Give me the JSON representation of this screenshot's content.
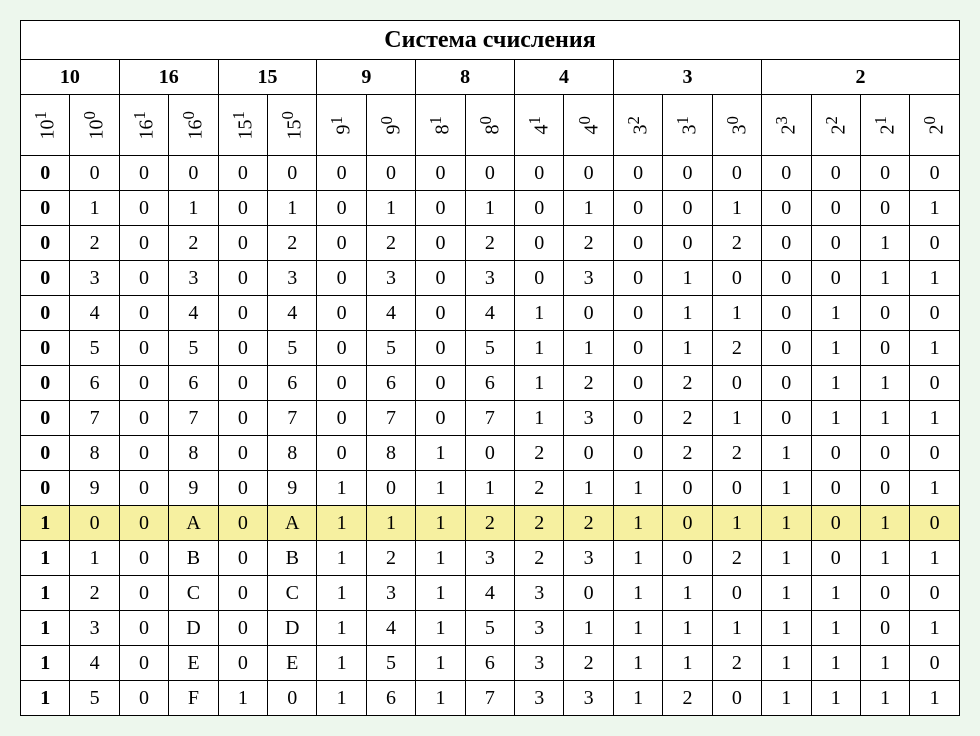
{
  "title": "Система счисления",
  "bases": [
    {
      "label": "10",
      "span": 2,
      "digits": [
        "10<sup>1</sup>",
        "10<sup>0</sup>"
      ]
    },
    {
      "label": "16",
      "span": 2,
      "digits": [
        "16<sup>1</sup>",
        "16<sup>0</sup>"
      ]
    },
    {
      "label": "15",
      "span": 2,
      "digits": [
        "15<sup>1</sup>",
        "15<sup>0</sup>"
      ]
    },
    {
      "label": "9",
      "span": 2,
      "digits": [
        "9<sup>1</sup>",
        "9<sup>0</sup>"
      ]
    },
    {
      "label": "8",
      "span": 2,
      "digits": [
        "8<sup>1</sup>",
        "8<sup>0</sup>"
      ]
    },
    {
      "label": "4",
      "span": 2,
      "digits": [
        "4<sup>1</sup>",
        "4<sup>0</sup>"
      ]
    },
    {
      "label": "3",
      "span": 3,
      "digits": [
        "3<sup>2</sup>",
        "3<sup>1</sup>",
        "3<sup>0</sup>"
      ]
    },
    {
      "label": "2",
      "span": 4,
      "digits": [
        "2<sup>3</sup>",
        "2<sup>2</sup>",
        "2<sup>1</sup>",
        "2<sup>0</sup>"
      ]
    }
  ],
  "highlight_row": 10,
  "rows": [
    [
      "0",
      "0",
      "0",
      "0",
      "0",
      "0",
      "0",
      "0",
      "0",
      "0",
      "0",
      "0",
      "0",
      "0",
      "0",
      "0",
      "0",
      "0",
      "0"
    ],
    [
      "0",
      "1",
      "0",
      "1",
      "0",
      "1",
      "0",
      "1",
      "0",
      "1",
      "0",
      "1",
      "0",
      "0",
      "1",
      "0",
      "0",
      "0",
      "1"
    ],
    [
      "0",
      "2",
      "0",
      "2",
      "0",
      "2",
      "0",
      "2",
      "0",
      "2",
      "0",
      "2",
      "0",
      "0",
      "2",
      "0",
      "0",
      "1",
      "0"
    ],
    [
      "0",
      "3",
      "0",
      "3",
      "0",
      "3",
      "0",
      "3",
      "0",
      "3",
      "0",
      "3",
      "0",
      "1",
      "0",
      "0",
      "0",
      "1",
      "1"
    ],
    [
      "0",
      "4",
      "0",
      "4",
      "0",
      "4",
      "0",
      "4",
      "0",
      "4",
      "1",
      "0",
      "0",
      "1",
      "1",
      "0",
      "1",
      "0",
      "0"
    ],
    [
      "0",
      "5",
      "0",
      "5",
      "0",
      "5",
      "0",
      "5",
      "0",
      "5",
      "1",
      "1",
      "0",
      "1",
      "2",
      "0",
      "1",
      "0",
      "1"
    ],
    [
      "0",
      "6",
      "0",
      "6",
      "0",
      "6",
      "0",
      "6",
      "0",
      "6",
      "1",
      "2",
      "0",
      "2",
      "0",
      "0",
      "1",
      "1",
      "0"
    ],
    [
      "0",
      "7",
      "0",
      "7",
      "0",
      "7",
      "0",
      "7",
      "0",
      "7",
      "1",
      "3",
      "0",
      "2",
      "1",
      "0",
      "1",
      "1",
      "1"
    ],
    [
      "0",
      "8",
      "0",
      "8",
      "0",
      "8",
      "0",
      "8",
      "1",
      "0",
      "2",
      "0",
      "0",
      "2",
      "2",
      "1",
      "0",
      "0",
      "0"
    ],
    [
      "0",
      "9",
      "0",
      "9",
      "0",
      "9",
      "1",
      "0",
      "1",
      "1",
      "2",
      "1",
      "1",
      "0",
      "0",
      "1",
      "0",
      "0",
      "1"
    ],
    [
      "1",
      "0",
      "0",
      "A",
      "0",
      "A",
      "1",
      "1",
      "1",
      "2",
      "2",
      "2",
      "1",
      "0",
      "1",
      "1",
      "0",
      "1",
      "0"
    ],
    [
      "1",
      "1",
      "0",
      "B",
      "0",
      "B",
      "1",
      "2",
      "1",
      "3",
      "2",
      "3",
      "1",
      "0",
      "2",
      "1",
      "0",
      "1",
      "1"
    ],
    [
      "1",
      "2",
      "0",
      "C",
      "0",
      "C",
      "1",
      "3",
      "1",
      "4",
      "3",
      "0",
      "1",
      "1",
      "0",
      "1",
      "1",
      "0",
      "0"
    ],
    [
      "1",
      "3",
      "0",
      "D",
      "0",
      "D",
      "1",
      "4",
      "1",
      "5",
      "3",
      "1",
      "1",
      "1",
      "1",
      "1",
      "1",
      "0",
      "1"
    ],
    [
      "1",
      "4",
      "0",
      "E",
      "0",
      "E",
      "1",
      "5",
      "1",
      "6",
      "3",
      "2",
      "1",
      "1",
      "2",
      "1",
      "1",
      "1",
      "0"
    ],
    [
      "1",
      "5",
      "0",
      "F",
      "1",
      "0",
      "1",
      "6",
      "1",
      "7",
      "3",
      "3",
      "1",
      "2",
      "0",
      "1",
      "1",
      "1",
      "1"
    ]
  ],
  "chart_data": {
    "type": "table",
    "title": "Система счисления",
    "columns": [
      "10^1",
      "10^0",
      "16^1",
      "16^0",
      "15^1",
      "15^0",
      "9^1",
      "9^0",
      "8^1",
      "8^0",
      "4^1",
      "4^0",
      "3^2",
      "3^1",
      "3^0",
      "2^3",
      "2^2",
      "2^1",
      "2^0"
    ],
    "column_groups": [
      {
        "base": 10,
        "cols": 2
      },
      {
        "base": 16,
        "cols": 2
      },
      {
        "base": 15,
        "cols": 2
      },
      {
        "base": 9,
        "cols": 2
      },
      {
        "base": 8,
        "cols": 2
      },
      {
        "base": 4,
        "cols": 2
      },
      {
        "base": 3,
        "cols": 3
      },
      {
        "base": 2,
        "cols": 4
      }
    ],
    "highlight_row_index": 10,
    "rows": [
      [
        "0",
        "0",
        "0",
        "0",
        "0",
        "0",
        "0",
        "0",
        "0",
        "0",
        "0",
        "0",
        "0",
        "0",
        "0",
        "0",
        "0",
        "0",
        "0"
      ],
      [
        "0",
        "1",
        "0",
        "1",
        "0",
        "1",
        "0",
        "1",
        "0",
        "1",
        "0",
        "1",
        "0",
        "0",
        "1",
        "0",
        "0",
        "0",
        "1"
      ],
      [
        "0",
        "2",
        "0",
        "2",
        "0",
        "2",
        "0",
        "2",
        "0",
        "2",
        "0",
        "2",
        "0",
        "0",
        "2",
        "0",
        "0",
        "1",
        "0"
      ],
      [
        "0",
        "3",
        "0",
        "3",
        "0",
        "3",
        "0",
        "3",
        "0",
        "3",
        "0",
        "3",
        "0",
        "1",
        "0",
        "0",
        "0",
        "1",
        "1"
      ],
      [
        "0",
        "4",
        "0",
        "4",
        "0",
        "4",
        "0",
        "4",
        "0",
        "4",
        "1",
        "0",
        "0",
        "1",
        "1",
        "0",
        "1",
        "0",
        "0"
      ],
      [
        "0",
        "5",
        "0",
        "5",
        "0",
        "5",
        "0",
        "5",
        "0",
        "5",
        "1",
        "1",
        "0",
        "1",
        "2",
        "0",
        "1",
        "0",
        "1"
      ],
      [
        "0",
        "6",
        "0",
        "6",
        "0",
        "6",
        "0",
        "6",
        "0",
        "6",
        "1",
        "2",
        "0",
        "2",
        "0",
        "0",
        "1",
        "1",
        "0"
      ],
      [
        "0",
        "7",
        "0",
        "7",
        "0",
        "7",
        "0",
        "7",
        "0",
        "7",
        "1",
        "3",
        "0",
        "2",
        "1",
        "0",
        "1",
        "1",
        "1"
      ],
      [
        "0",
        "8",
        "0",
        "8",
        "0",
        "8",
        "0",
        "8",
        "1",
        "0",
        "2",
        "0",
        "0",
        "2",
        "2",
        "1",
        "0",
        "0",
        "0"
      ],
      [
        "0",
        "9",
        "0",
        "9",
        "0",
        "9",
        "1",
        "0",
        "1",
        "1",
        "2",
        "1",
        "1",
        "0",
        "0",
        "1",
        "0",
        "0",
        "1"
      ],
      [
        "1",
        "0",
        "0",
        "A",
        "0",
        "A",
        "1",
        "1",
        "1",
        "2",
        "2",
        "2",
        "1",
        "0",
        "1",
        "1",
        "0",
        "1",
        "0"
      ],
      [
        "1",
        "1",
        "0",
        "B",
        "0",
        "B",
        "1",
        "2",
        "1",
        "3",
        "2",
        "3",
        "1",
        "0",
        "2",
        "1",
        "0",
        "1",
        "1"
      ],
      [
        "1",
        "2",
        "0",
        "C",
        "0",
        "C",
        "1",
        "3",
        "1",
        "4",
        "3",
        "0",
        "1",
        "1",
        "0",
        "1",
        "1",
        "0",
        "0"
      ],
      [
        "1",
        "3",
        "0",
        "D",
        "0",
        "D",
        "1",
        "4",
        "1",
        "5",
        "3",
        "1",
        "1",
        "1",
        "1",
        "1",
        "1",
        "0",
        "1"
      ],
      [
        "1",
        "4",
        "0",
        "E",
        "0",
        "E",
        "1",
        "5",
        "1",
        "6",
        "3",
        "2",
        "1",
        "1",
        "2",
        "1",
        "1",
        "1",
        "0"
      ],
      [
        "1",
        "5",
        "0",
        "F",
        "1",
        "0",
        "1",
        "6",
        "1",
        "7",
        "3",
        "3",
        "1",
        "2",
        "0",
        "1",
        "1",
        "1",
        "1"
      ]
    ]
  }
}
